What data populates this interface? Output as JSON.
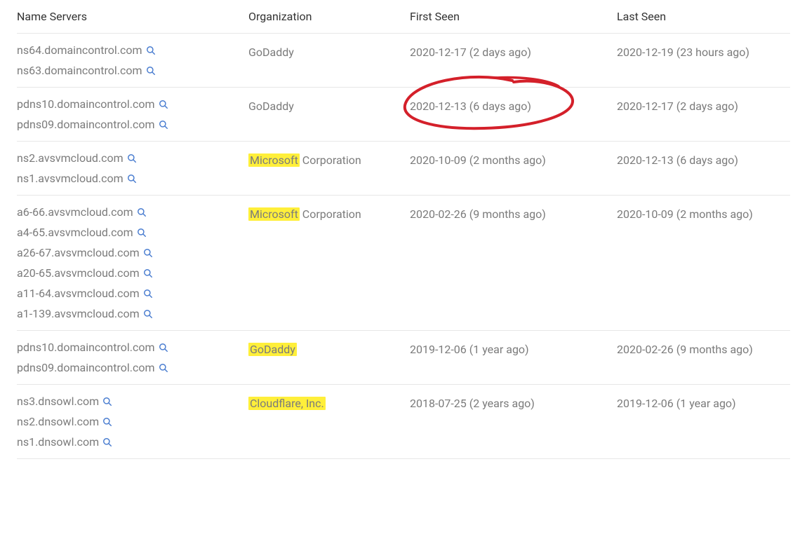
{
  "headers": {
    "name_servers": "Name Servers",
    "organization": "Organization",
    "first_seen": "First Seen",
    "last_seen": "Last Seen"
  },
  "rows": [
    {
      "name_servers": [
        "ns64.domaincontrol.com",
        "ns63.domaincontrol.com"
      ],
      "organization": "GoDaddy",
      "org_highlight": false,
      "first_seen": "2020-12-17 (2 days ago)",
      "first_seen_circled": false,
      "last_seen": "2020-12-19 (23 hours ago)"
    },
    {
      "name_servers": [
        "pdns10.domaincontrol.com",
        "pdns09.domaincontrol.com"
      ],
      "organization": "GoDaddy",
      "org_highlight": false,
      "first_seen": "2020-12-13 (6 days ago)",
      "first_seen_circled": true,
      "last_seen": "2020-12-17 (2 days ago)"
    },
    {
      "name_servers": [
        "ns2.avsvmcloud.com",
        "ns1.avsvmcloud.com"
      ],
      "organization": "Microsoft Corporation",
      "org_highlight_prefix": "Microsoft",
      "org_highlight_suffix": " Corporation",
      "org_highlight": true,
      "first_seen": "2020-10-09 (2 months ago)",
      "first_seen_circled": false,
      "last_seen": "2020-12-13 (6 days ago)"
    },
    {
      "name_servers": [
        "a6-66.avsvmcloud.com",
        "a4-65.avsvmcloud.com",
        "a26-67.avsvmcloud.com",
        "a20-65.avsvmcloud.com",
        "a11-64.avsvmcloud.com",
        "a1-139.avsvmcloud.com"
      ],
      "organization": "Microsoft Corporation",
      "org_highlight_prefix": "Microsoft",
      "org_highlight_suffix": " Corporation",
      "org_highlight": true,
      "first_seen": "2020-02-26 (9 months ago)",
      "first_seen_circled": false,
      "last_seen": "2020-10-09 (2 months ago)"
    },
    {
      "name_servers": [
        "pdns10.domaincontrol.com",
        "pdns09.domaincontrol.com"
      ],
      "organization": "GoDaddy",
      "org_highlight_prefix": "GoDaddy",
      "org_highlight_suffix": "",
      "org_highlight": true,
      "first_seen": "2019-12-06 (1 year ago)",
      "first_seen_circled": false,
      "last_seen": "2020-02-26 (9 months ago)"
    },
    {
      "name_servers": [
        "ns3.dnsowl.com",
        "ns2.dnsowl.com",
        "ns1.dnsowl.com"
      ],
      "organization": "Cloudflare, Inc.",
      "org_highlight_prefix": "Cloudflare, Inc.",
      "org_highlight_suffix": "",
      "org_highlight": true,
      "first_seen": "2018-07-25 (2 years ago)",
      "first_seen_circled": false,
      "last_seen": "2019-12-06 (1 year ago)"
    }
  ]
}
